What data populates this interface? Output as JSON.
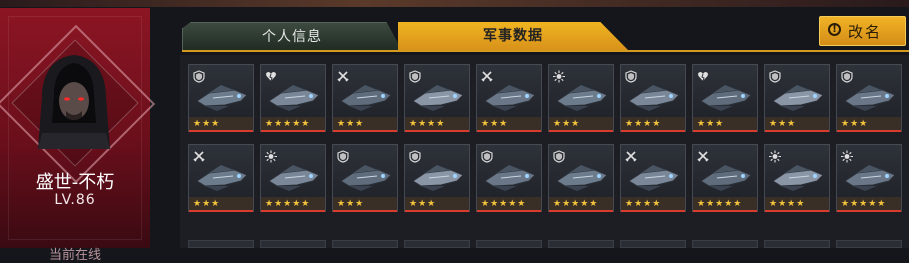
{
  "player": {
    "name": "盛世-不朽",
    "level": "LV.86",
    "status": "当前在线"
  },
  "tabs": [
    {
      "label": "个人信息"
    },
    {
      "label": "军事数据"
    }
  ],
  "rename_button": {
    "label": "改名"
  },
  "colors": {
    "accent": "#f0b421",
    "panel_red": "#8c1523",
    "star": "#f2c23c",
    "star_bar_border": "#d93b2c"
  },
  "ships_row1": [
    {
      "badge": "shield-icon",
      "stars": 3
    },
    {
      "badge": "broken-heart-icon",
      "stars": 5
    },
    {
      "badge": "crossed-swords-icon",
      "stars": 3
    },
    {
      "badge": "shield-icon",
      "stars": 4
    },
    {
      "badge": "crossed-swords-icon",
      "stars": 3
    },
    {
      "badge": "burst-icon",
      "stars": 3
    },
    {
      "badge": "shield-icon",
      "stars": 4
    },
    {
      "badge": "broken-heart-icon",
      "stars": 3
    },
    {
      "badge": "shield-icon",
      "stars": 3
    },
    {
      "badge": "shield-icon",
      "stars": 3
    }
  ],
  "ships_row2": [
    {
      "badge": "crossed-swords-icon",
      "stars": 3
    },
    {
      "badge": "burst-icon",
      "stars": 5
    },
    {
      "badge": "shield-icon",
      "stars": 3
    },
    {
      "badge": "shield-icon",
      "stars": 3
    },
    {
      "badge": "shield-icon",
      "stars": 5
    },
    {
      "badge": "shield-icon",
      "stars": 5
    },
    {
      "badge": "crossed-swords-icon",
      "stars": 4
    },
    {
      "badge": "crossed-swords-icon",
      "stars": 5
    },
    {
      "badge": "burst-icon",
      "stars": 4
    },
    {
      "badge": "burst-icon",
      "stars": 5
    }
  ]
}
